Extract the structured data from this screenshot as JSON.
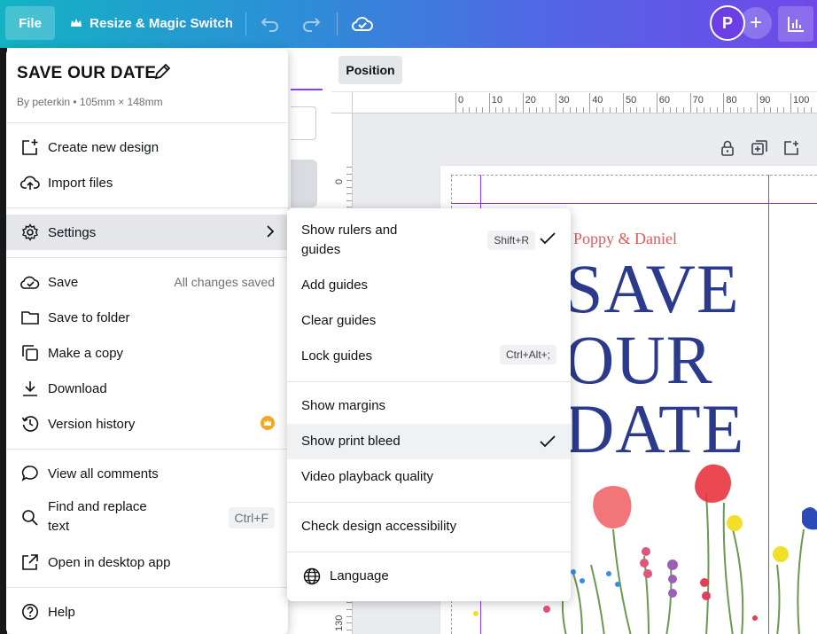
{
  "topbar": {
    "file_label": "File",
    "resize_label": "Resize & Magic Switch",
    "avatar_initial": "P",
    "accent": "#7048e8"
  },
  "toolbar": {
    "position_label": "Position"
  },
  "ruler": {
    "h_labels": [
      "0",
      "10",
      "20",
      "30",
      "40",
      "50",
      "60",
      "70",
      "80",
      "90",
      "100"
    ],
    "v_labels": [
      "0",
      "130"
    ]
  },
  "design": {
    "names": "Poppy & Daniel",
    "line1": "SAVE",
    "line2": "OUR",
    "line3": "DATE",
    "text_color": "#2c3a8c",
    "names_color": "#e05a5a"
  },
  "file_menu": {
    "title": "SAVE OUR DATE",
    "subtitle": "By peterkin • 105mm × 148mm",
    "items": {
      "create": "Create new design",
      "import": "Import files",
      "settings": "Settings",
      "save": "Save",
      "save_status": "All changes saved",
      "save_folder": "Save to folder",
      "copy": "Make a copy",
      "download": "Download",
      "version": "Version history",
      "comments": "View all comments",
      "find_line1": "Find and replace",
      "find_line2": "text",
      "find_shortcut": "Ctrl+F",
      "desktop": "Open in desktop app",
      "help": "Help"
    }
  },
  "settings_menu": {
    "rulers_line1": "Show rulers and",
    "rulers_line2": "guides",
    "rulers_shortcut": "Shift+R",
    "add_guides": "Add guides",
    "clear_guides": "Clear guides",
    "lock_guides": "Lock guides",
    "lock_shortcut": "Ctrl+Alt+;",
    "show_margins": "Show margins",
    "show_bleed": "Show print bleed",
    "video_quality": "Video playback quality",
    "accessibility": "Check design accessibility",
    "language": "Language"
  }
}
